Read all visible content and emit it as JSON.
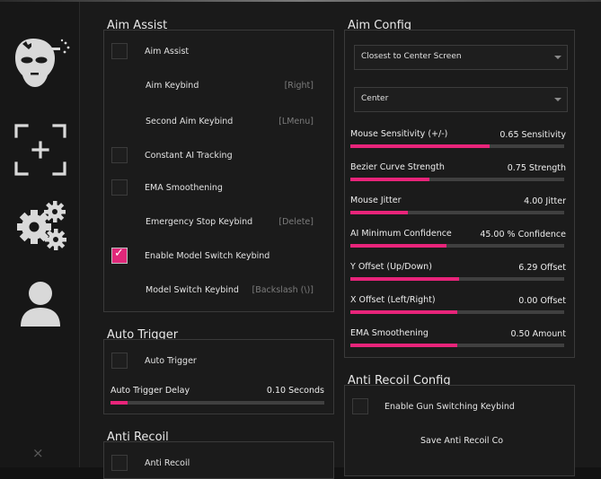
{
  "nav": {
    "items": [
      {
        "name": "aim",
        "icon": "aim-head-icon"
      },
      {
        "name": "trigger",
        "icon": "crosshair-icon"
      },
      {
        "name": "settings",
        "icon": "gears-icon"
      },
      {
        "name": "profile",
        "icon": "user-icon"
      }
    ],
    "close_glyph": "×"
  },
  "aim_assist": {
    "title": "Aim Assist",
    "rows": [
      {
        "type": "checkbox",
        "label": "Aim Assist",
        "checked": false
      },
      {
        "type": "keybind",
        "label": "Aim Keybind",
        "value": "[Right]"
      },
      {
        "type": "keybind",
        "label": "Second Aim Keybind",
        "value": "[LMenu]"
      },
      {
        "type": "checkbox",
        "label": "Constant AI Tracking",
        "checked": false
      },
      {
        "type": "checkbox",
        "label": "EMA Smoothening",
        "checked": false
      },
      {
        "type": "keybind",
        "label": "Emergency Stop Keybind",
        "value": "[Delete]"
      },
      {
        "type": "checkbox",
        "label": "Enable Model Switch Keybind",
        "checked": true
      },
      {
        "type": "keybind",
        "label": "Model Switch Keybind",
        "value": "[Backslash (\\)]"
      }
    ]
  },
  "auto_trigger": {
    "title": "Auto Trigger",
    "checkbox_label": "Auto Trigger",
    "checked": false,
    "delay_label": "Auto Trigger Delay",
    "delay_value": "0.10 Seconds",
    "delay_fraction": 0.08
  },
  "anti_recoil": {
    "title": "Anti Recoil",
    "checkbox_label": "Anti Recoil",
    "checked": false
  },
  "aim_config": {
    "title": "Aim Config",
    "target_select": "Closest to Center Screen",
    "aim_point_select": "Center",
    "sliders": [
      {
        "label": "Mouse Sensitivity (+/-)",
        "value": "0.65 Sensitivity",
        "fraction": 0.65
      },
      {
        "label": "Bezier Curve Strength",
        "value": "0.75 Strength",
        "fraction": 0.37
      },
      {
        "label": "Mouse Jitter",
        "value": "4.00 Jitter",
        "fraction": 0.27
      },
      {
        "label": "AI Minimum Confidence",
        "value": "45.00 % Confidence",
        "fraction": 0.45
      },
      {
        "label": "Y Offset (Up/Down)",
        "value": "6.29 Offset",
        "fraction": 0.51
      },
      {
        "label": "X Offset (Left/Right)",
        "value": "0.00 Offset",
        "fraction": 0.5
      },
      {
        "label": "EMA Smoothening",
        "value": "0.50 Amount",
        "fraction": 0.5
      }
    ]
  },
  "anti_recoil_config": {
    "title": "Anti Recoil Config",
    "checkbox_label": "Enable Gun Switching Keybind",
    "checked": false,
    "save_label": "Save Anti Recoil Co"
  },
  "colors": {
    "accent": "#e8247a",
    "panel": "#1b1b1b",
    "border": "#3a3a3a"
  }
}
